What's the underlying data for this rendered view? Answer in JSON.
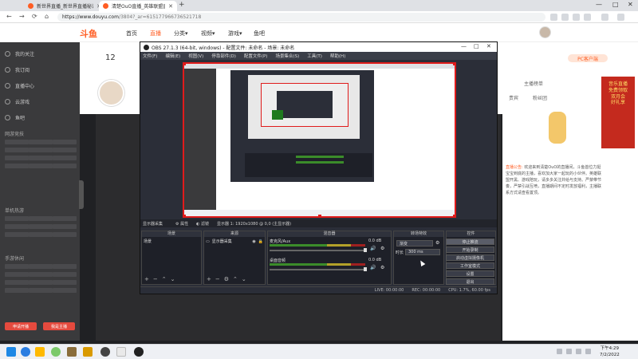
{
  "browser": {
    "tabs": [
      {
        "title": "新世界直播_新世界直播秘诀(附)",
        "active": false
      },
      {
        "title": "清楚OuO直播_英雄联盟直播_斗",
        "active": true
      }
    ],
    "url_host": "https://www.douyu.com",
    "url_path": "/3804?_ar=615177966736521718",
    "new_tab": "+",
    "window_controls": [
      "—",
      "□",
      "✕"
    ]
  },
  "site": {
    "logo": "斗鱼",
    "nav": [
      "首页",
      "直播",
      "分类▾",
      "视频▾",
      "游戏▾",
      "鱼吧"
    ],
    "active_nav": 1,
    "follow_count": "12",
    "pc_badge": "PC客户端",
    "promo": [
      "音乐直播",
      "免费领取",
      "双月会",
      "好礼享"
    ],
    "right_texts": [
      "主播榜单",
      "贵宾",
      "粉丝团"
    ],
    "announce_tag": "直播公告:",
    "announce": "欢迎来到清楚OuO的直播间，斗鱼首位力挺宝宝到底的主播，喜欢加大家一起玩的小伙伴。英雄联盟开黑、游戏陪玩，请多多关注并给与支持。严禁带节奏，严禁引战互喷，直播期间不定时发放福利，主播联系方式请查看置顶。",
    "sidebar_items": [
      "我的关注",
      "我订阅",
      "直播中心",
      "云游戏",
      "鱼吧"
    ],
    "sidebar_headings": [
      "网游竞技",
      "单机热游",
      "手游休闲"
    ],
    "sidebar_buttons": [
      "申请开播",
      "我是主播"
    ]
  },
  "obs": {
    "title": "OBS 27.1.3 (64-bit, windows) - 配置文件: 未命名 - 场景: 未命名",
    "window_controls": [
      "—",
      "□",
      "✕"
    ],
    "menu": [
      "文件(F)",
      "编辑(E)",
      "视图(V)",
      "停靠部件(D)",
      "配置文件(P)",
      "场景集合(S)",
      "工具(T)",
      "帮助(H)"
    ],
    "ctx": {
      "source": "显示器采集",
      "props": "⚙ 属性",
      "filters": "◐ 滤镜",
      "display_label": "显示器 1: 1920x1080 @ 0,0 (主显示器)"
    },
    "docks": {
      "scenes": {
        "title": "场景",
        "items": [
          "场景"
        ]
      },
      "sources": {
        "title": "来源",
        "items": [
          "显示器采集"
        ]
      },
      "mixer": {
        "title": "混音器",
        "channels": [
          {
            "name": "麦克风/Aux",
            "db": "0.0 dB"
          },
          {
            "name": "桌面音频",
            "db": "0.0 dB"
          }
        ]
      },
      "transitions": {
        "title": "转场特效",
        "type": "渐变",
        "duration_label": "时长",
        "duration": "300 ms"
      },
      "controls": {
        "title": "控件",
        "buttons": [
          "停止推流",
          "开始录制",
          "启动虚拟摄像机",
          "工作室模式",
          "设置",
          "退出"
        ]
      }
    },
    "status": {
      "live": "LIVE: 00:00:00",
      "rec": "REC: 00:00:00",
      "cpu": "CPU: 1.7%, 60.00 fps"
    }
  },
  "taskbar": {
    "time": "下午4:29",
    "date": "7/2/2022"
  },
  "colors": {
    "accent": "#ff5d23",
    "obs_bg": "#2b2e38",
    "preview_border": "#e01b1b"
  }
}
